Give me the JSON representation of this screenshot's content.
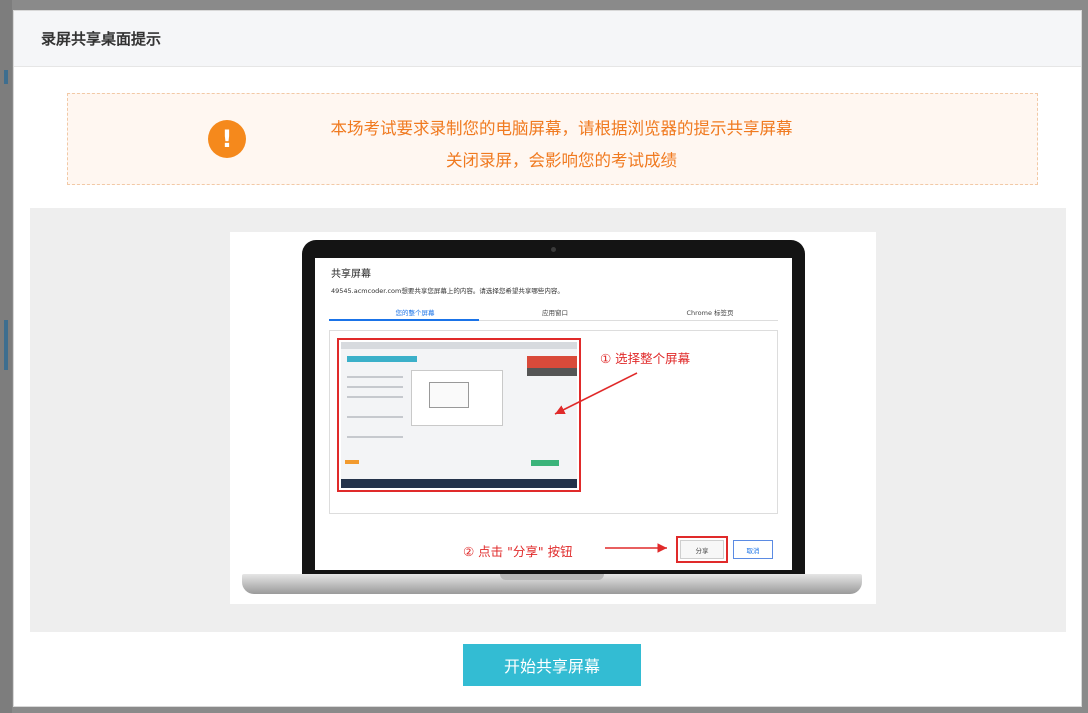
{
  "dialog": {
    "title": "录屏共享桌面提示"
  },
  "alert": {
    "icon": "exclamation-icon",
    "icon_glyph": "!",
    "line1": "本场考试要求录制您的电脑屏幕，请根据浏览器的提示共享屏幕",
    "line2": "关闭录屏，会影响您的考试成绩",
    "color": "#f07a20"
  },
  "illustration": {
    "dialog_title": "共享屏幕",
    "dialog_desc": "49545.acmcoder.com想要共享您屏幕上的内容。请选择您希望共享哪些内容。",
    "tabs": [
      "您的整个屏幕",
      "应用窗口",
      "Chrome 标签页"
    ],
    "step1": "① 选择整个屏幕",
    "step2": "② 点击 \"分享\" 按钮",
    "share_button": "分享",
    "cancel_button": "取消"
  },
  "actions": {
    "start_button": "开始共享屏幕",
    "color": "#33bcd3"
  }
}
